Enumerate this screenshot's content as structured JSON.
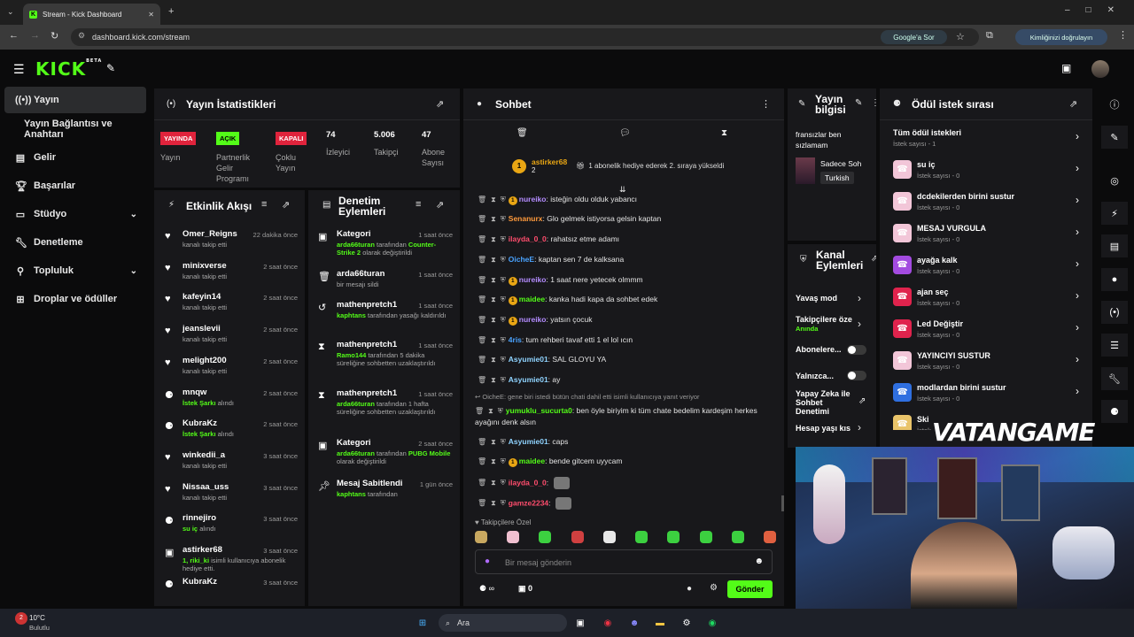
{
  "browser": {
    "tab_title": "Stream - Kick Dashboard",
    "url": "dashboard.kick.com/stream",
    "google_ask": "Google'a Sor",
    "verify": "Kimliğinizi doğrulayın"
  },
  "header": {
    "logo": "KICK",
    "beta": "BETA"
  },
  "sidebar": {
    "items": [
      {
        "label": "Yayın",
        "icon": "broadcast-icon"
      },
      {
        "label": "Yayın Bağlantısı ve Anahtarı"
      },
      {
        "label": "Gelir",
        "icon": "revenue-icon"
      },
      {
        "label": "Başarılar",
        "icon": "trophy-icon"
      },
      {
        "label": "Stüdyo",
        "icon": "studio-icon"
      },
      {
        "label": "Denetleme",
        "icon": "wrench-icon"
      },
      {
        "label": "Topluluk",
        "icon": "community-icon"
      },
      {
        "label": "Droplar ve ödüller",
        "icon": "drops-icon"
      }
    ]
  },
  "stats": {
    "title": "Yayın İstatistikleri",
    "live_badge": "YAYINDA",
    "live_label": "Yayın",
    "partner_badge": "AÇIK",
    "partner_label": "Partnerlik Gelir Programı",
    "multi_badge": "KAPALI",
    "multi_label": "Çoklu Yayın",
    "viewers": "74",
    "viewers_label": "İzleyici",
    "followers": "5.006",
    "followers_label": "Takipçi",
    "subs": "47",
    "subs_label": "Abone Sayısı"
  },
  "activity": {
    "title": "Etkinlik Akışı",
    "items": [
      {
        "name": "Omer_Reigns",
        "time": "22 dakika önce",
        "desc": "kanalı takip etti",
        "accent": ""
      },
      {
        "name": "minixverse",
        "time": "2 saat önce",
        "desc": "kanalı takip etti",
        "accent": ""
      },
      {
        "name": "kafeyin14",
        "time": "2 saat önce",
        "desc": "kanalı takip etti",
        "accent": ""
      },
      {
        "name": "jeanslevii",
        "time": "2 saat önce",
        "desc": "kanalı takip etti",
        "accent": ""
      },
      {
        "name": "melight200",
        "time": "2 saat önce",
        "desc": "kanalı takip etti",
        "accent": ""
      },
      {
        "name": "mnqw",
        "time": "2 saat önce",
        "desc": "alındı",
        "accent": "İstek Şarkı"
      },
      {
        "name": "KubraKz",
        "time": "2 saat önce",
        "desc": "alındı",
        "accent": "İstek Şarkı"
      },
      {
        "name": "winkedii_a",
        "time": "3 saat önce",
        "desc": "kanalı takip etti",
        "accent": ""
      },
      {
        "name": "Nissaa_uss",
        "time": "3 saat önce",
        "desc": "kanalı takip etti",
        "accent": ""
      },
      {
        "name": "rinnejiro",
        "time": "3 saat önce",
        "desc": "alındı",
        "accent": "su iç"
      },
      {
        "name": "astirker68",
        "time": "3 saat önce",
        "desc": "isimli kullanıcıya abonelik hediye etti.",
        "accent": "1, riki_ki"
      },
      {
        "name": "KubraKz",
        "time": "3 saat önce",
        "desc": "",
        "accent": ""
      }
    ]
  },
  "modactions": {
    "title": "Denetim Eylemleri",
    "items": [
      {
        "name": "Kategori",
        "time": "1 saat önce",
        "accent": "arda66turan",
        "desc": "tarafından",
        "accent2": "Counter-Strike 2",
        "desc2": "olarak değiştirildi"
      },
      {
        "name": "arda66turan",
        "time": "1 saat önce",
        "accent": "",
        "desc": "bir mesajı sildi",
        "accent2": "",
        "desc2": ""
      },
      {
        "name": "mathenpretch1",
        "time": "1 saat önce",
        "accent": "kaphtans",
        "desc": "tarafından yasağı kaldırıldı",
        "accent2": "",
        "desc2": ""
      },
      {
        "name": "mathenpretch1",
        "time": "1 saat önce",
        "accent": "Ramo144",
        "desc": "tarafından 5 dakika süreliğine sohbetten uzaklaştırıldı",
        "accent2": "",
        "desc2": ""
      },
      {
        "name": "mathenpretch1",
        "time": "1 saat önce",
        "accent": "arda66turan",
        "desc": "tarafından 1 hafta süreliğine sohbetten uzaklaştırıldı",
        "accent2": "",
        "desc2": ""
      },
      {
        "name": "Kategori",
        "time": "2 saat önce",
        "accent": "arda66turan",
        "desc": "tarafından",
        "accent2": "PUBG Mobile",
        "desc2": "olarak değiştirildi"
      },
      {
        "name": "Mesaj Sabitlendi",
        "time": "1 gün önce",
        "accent": "kaphtans",
        "desc": "tarafından",
        "accent2": "",
        "desc2": ""
      }
    ]
  },
  "chat": {
    "title": "Sohbet",
    "pinned_user": "astirker68",
    "pinned_count": "2",
    "pinned_text": "1 abonelik hediye ederek 2. sıraya yükseldi",
    "reply_note": "OicheE: gene biri istedi bütün chati dahil etti isimli kullanıcıya yanıt veriyor",
    "messages": [
      {
        "user": "nureiko",
        "color": "#b48cff",
        "text": "isteğin oldu olduk yabancı"
      },
      {
        "user": "Senanurx",
        "color": "#ff9a3c",
        "text": "Glo gelmek istiyorsa gelsin kaptan"
      },
      {
        "user": "ilayda_0_0",
        "color": "#ff4d6d",
        "text": "rahatsız etme adamı"
      },
      {
        "user": "OicheE",
        "color": "#4aa3ff",
        "text": "kaptan sen 7 de kalksana"
      },
      {
        "user": "nureiko",
        "color": "#b48cff",
        "text": "1 saat nere yetecek olmmm"
      },
      {
        "user": "maidee",
        "color": "#53fc18",
        "text": "kanka hadi kapa da sohbet edek"
      },
      {
        "user": "nureiko",
        "color": "#b48cff",
        "text": "yatsın çocuk"
      },
      {
        "user": "4ris",
        "color": "#4aa3ff",
        "text": "tum rehberi tavaf etti 1 el lol ıcın"
      },
      {
        "user": "Asyumie01",
        "color": "#8fd3ff",
        "text": "SAL GLOYU YA"
      },
      {
        "user": "Asyumie01",
        "color": "#8fd3ff",
        "text": "ay"
      },
      {
        "user": "yumuklu_sucurta0",
        "color": "#53fc18",
        "text": "ben öyle biriyim ki tüm chate bedelim kardeşim herkes ayağını denk alsın"
      },
      {
        "user": "Asyumie01",
        "color": "#8fd3ff",
        "text": "caps"
      },
      {
        "user": "maidee",
        "color": "#53fc18",
        "text": "bende gitcem uyycam"
      },
      {
        "user": "ilayda_0_0",
        "color": "#ff4d6d",
        "text": ""
      },
      {
        "user": "gamze2234",
        "color": "#ff4d6d",
        "text": ""
      }
    ],
    "emote_label": "Takipçilere Özel",
    "placeholder": "Bir mesaj gönderin",
    "count_left": "∞",
    "count_right": "0",
    "send": "Gönder"
  },
  "streaminfo": {
    "title": "Yayın bilgisi",
    "stream_title": "fransızlar ben sızlamam",
    "category": "Sadece Soh",
    "language": "Turkish"
  },
  "channelactions": {
    "title": "Kanal Eylemleri",
    "slow": "Yavaş mod",
    "followers_only": "Takipçilere öze",
    "followers_state": "Anında",
    "subs_only": "Abonelere...",
    "emotes_only": "Yalnızca...",
    "ai": "Yapay Zeka ile Sohbet Denetimi",
    "account_age": "Hesap yaşı kıs"
  },
  "rewards": {
    "title": "Ödül istek sırası",
    "all": "Tüm ödül istekleri",
    "all_count": "İstek sayısı - 1",
    "items": [
      {
        "name": "su iç",
        "count": "İstek sayısı - 0",
        "color": "#f2c6d8"
      },
      {
        "name": "dcdekilerden birini sustur",
        "count": "İstek sayısı - 0",
        "color": "#f2c6d8"
      },
      {
        "name": "MESAJ VURGULA",
        "count": "İstek sayısı - 0",
        "color": "#f2c6d8"
      },
      {
        "name": "ayağa kalk",
        "count": "İstek sayısı - 0",
        "color": "#a34be0"
      },
      {
        "name": "ajan seç",
        "count": "İstek sayısı - 0",
        "color": "#e0234d"
      },
      {
        "name": "Led Değiştir",
        "count": "İstek sayısı - 0",
        "color": "#e0234d"
      },
      {
        "name": "YAYINCIYI SUSTUR",
        "count": "İstek sayısı - 0",
        "color": "#f2c6d8"
      },
      {
        "name": "modlardan birini sustur",
        "count": "İstek sayısı - 0",
        "color": "#2f6fe0"
      },
      {
        "name": "Ski",
        "count": "İstek",
        "color": "#e9c46a"
      }
    ]
  },
  "watermark": "VATANGAME",
  "taskbar": {
    "temp": "10°C",
    "weather": "Bulutlu",
    "search": "Ara"
  }
}
